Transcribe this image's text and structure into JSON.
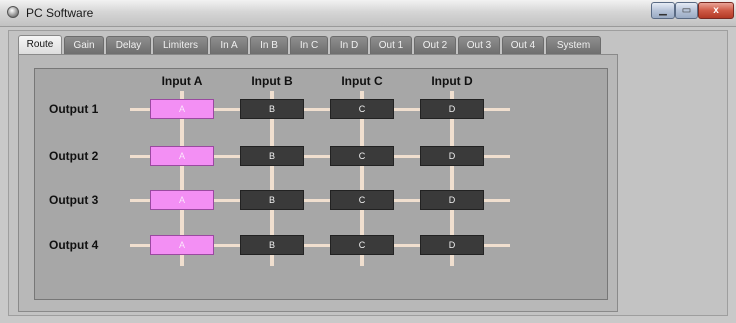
{
  "window": {
    "title": "PC Software",
    "min_glyph": "▁",
    "max_glyph": "▭",
    "close_glyph": "x"
  },
  "tabs": [
    {
      "label": "Route",
      "active": true
    },
    {
      "label": "Gain"
    },
    {
      "label": "Delay"
    },
    {
      "label": "Limiters"
    },
    {
      "label": "In A"
    },
    {
      "label": "In B"
    },
    {
      "label": "In C"
    },
    {
      "label": "In D"
    },
    {
      "label": "Out 1"
    },
    {
      "label": "Out 2"
    },
    {
      "label": "Out 3"
    },
    {
      "label": "Out 4"
    },
    {
      "label": "System"
    }
  ],
  "matrix": {
    "inputs": [
      "Input A",
      "Input B",
      "Input C",
      "Input D"
    ],
    "outputs": [
      "Output 1",
      "Output 2",
      "Output 3",
      "Output 4"
    ],
    "cell_labels": [
      "A",
      "B",
      "C",
      "D"
    ],
    "routing": [
      [
        true,
        false,
        false,
        false
      ],
      [
        true,
        false,
        false,
        false
      ],
      [
        true,
        false,
        false,
        false
      ],
      [
        true,
        false,
        false,
        false
      ]
    ],
    "colors": {
      "on": "#f38ff4",
      "off": "#3a3a3a",
      "line": "#f0dfcf"
    }
  }
}
